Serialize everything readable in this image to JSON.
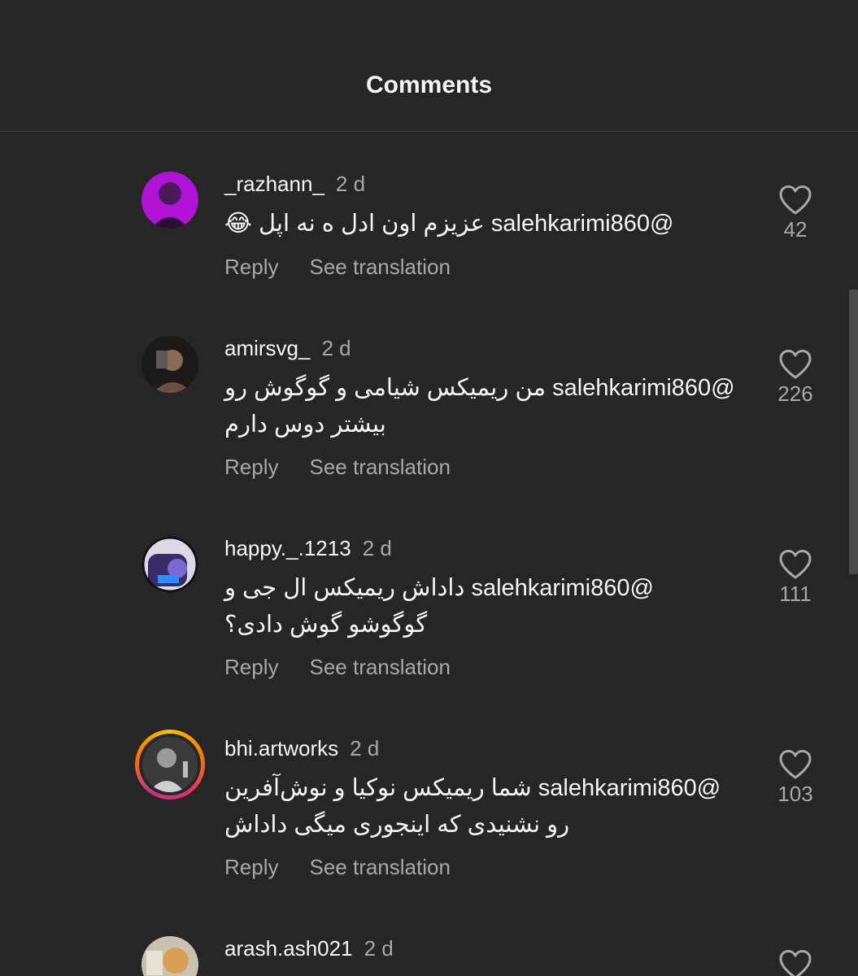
{
  "header": {
    "title": "Comments"
  },
  "comments": [
    {
      "username": "_razhann_",
      "time": "2 d",
      "lines": [
        "@salehkarimi860 عزیزم اون ادل ه نه اپل 😂"
      ],
      "reply": "Reply",
      "translate": "See translation",
      "likes": "42"
    },
    {
      "username": "amirsvg_",
      "time": "2 d",
      "lines": [
        "@salehkarimi860 من ریمیکس شیامی و گوگوش رو",
        "بیشتر دوس دارم"
      ],
      "reply": "Reply",
      "translate": "See translation",
      "likes": "226"
    },
    {
      "username": "happy._.1213",
      "time": "2 d",
      "lines": [
        "@salehkarimi860 داداش ریمیکس ال جی و",
        "گوگوشو گوش دادی؟"
      ],
      "reply": "Reply",
      "translate": "See translation",
      "likes": "111"
    },
    {
      "username": "bhi.artworks",
      "time": "2 d",
      "lines": [
        "@salehkarimi860 شما ریمیکس نوکیا و نوش‌آفرین",
        "رو نشنیدی که اینجوری میگی داداش"
      ],
      "reply": "Reply",
      "translate": "See translation",
      "likes": "103"
    },
    {
      "username": "arash.ash021",
      "time": "2 d"
    }
  ],
  "icons": {
    "like": "heart-outline-icon"
  },
  "colors": {
    "background": "#262626",
    "text": "#f5f5f5",
    "secondary": "#a8a8a8"
  }
}
